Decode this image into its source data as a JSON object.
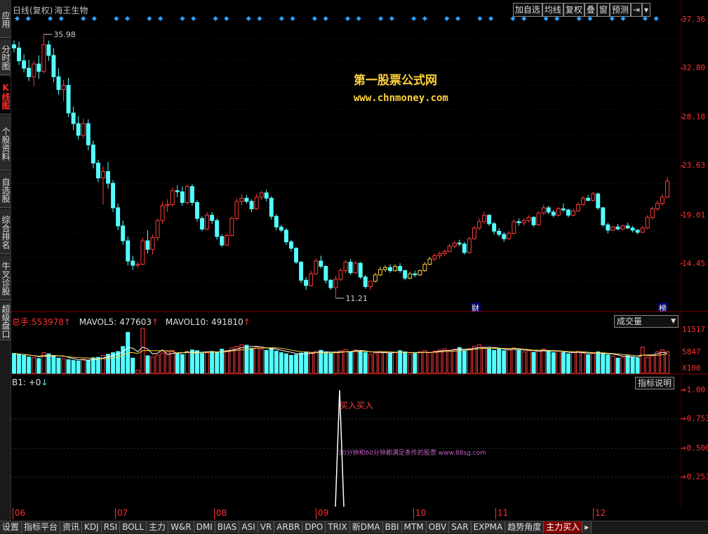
{
  "stock": {
    "period_label": "日线(复权)",
    "name": "海王生物"
  },
  "toolbar": [
    "加自选",
    "均线",
    "复权",
    "叠",
    "窗",
    "预测"
  ],
  "left_tabs": [
    {
      "label": "应用",
      "active": false
    },
    {
      "label": "分时图",
      "active": false
    },
    {
      "label": "K线图",
      "active": true
    },
    {
      "label": "个股资料",
      "active": false
    },
    {
      "label": "自选股",
      "active": false
    },
    {
      "label": "综合排名",
      "active": false
    },
    {
      "label": "牛叉诊股",
      "active": false
    },
    {
      "label": "超级盘口",
      "active": false
    }
  ],
  "price_axis": [
    "37.36",
    "32.80",
    "28.18",
    "23.63",
    "19.01",
    "14.45"
  ],
  "watermark": {
    "line1": "第一股票公式网",
    "line2": "www.chnmoney.com"
  },
  "annotations": {
    "high": "35.98",
    "low": "11.21",
    "cai": "财",
    "bang": "榜"
  },
  "volume": {
    "total_label": "总手:",
    "total_value": "553978",
    "mavol5_label": "MAVOL5:",
    "mavol5_value": "477603",
    "mavol10_label": "MAVOL10:",
    "mavol10_value": "491810",
    "selector": "成交量",
    "axis": [
      "11517",
      "5847",
      "X100"
    ]
  },
  "indicator": {
    "title": "B1: +0",
    "button": "指标说明",
    "signal_text": "买入买入",
    "small_text": "30分钟和60分钟都满足条件的股票 www.88sg.com",
    "axis": [
      "+1.00",
      "+0.753",
      "+0.500",
      "+0.253"
    ]
  },
  "months": [
    "06",
    "07",
    "08",
    "09",
    "10",
    "11",
    "12"
  ],
  "bottom_tabs": [
    "设置",
    "指标平台",
    "资讯",
    "KDJ",
    "RSI",
    "BOLL",
    "主力",
    "W&R",
    "DMI",
    "BIAS",
    "ASI",
    "VR",
    "ARBR",
    "DPO",
    "TRIX",
    "新DMA",
    "BBI",
    "MTM",
    "OBV",
    "SAR",
    "EXPMA",
    "趋势角度",
    "主力买入"
  ],
  "active_bottom_tab": "主力买入",
  "colors": {
    "up": "#ff3c3c",
    "down": "#54ffff",
    "axis": "#ff3030",
    "grid": "#800000",
    "yellow": "#ffd23c",
    "ma": "#ffffff"
  },
  "chart_data": {
    "type": "candlestick",
    "ylim": [
      11.21,
      37.36
    ],
    "candles": [
      [
        35,
        35.4,
        34.3,
        34.7
      ],
      [
        34.7,
        35.3,
        33.1,
        33.5
      ],
      [
        33.5,
        34.1,
        32.4,
        32.8
      ],
      [
        32.8,
        33.6,
        31.6,
        32.0
      ],
      [
        32.0,
        33.5,
        31.1,
        33.2
      ],
      [
        33.2,
        34.0,
        31.8,
        32.5
      ],
      [
        32.5,
        35.98,
        32.3,
        35.0
      ],
      [
        35.0,
        35.4,
        33.5,
        34.0
      ],
      [
        34.0,
        34.7,
        31.5,
        32.0
      ],
      [
        32.0,
        32.8,
        30.3,
        30.8
      ],
      [
        30.8,
        31.7,
        29.7,
        31.2
      ],
      [
        31.2,
        31.9,
        28.2,
        28.6
      ],
      [
        28.6,
        29.2,
        27.0,
        27.6
      ],
      [
        27.6,
        28.3,
        26.1,
        26.5
      ],
      [
        26.5,
        28.1,
        26.2,
        27.6
      ],
      [
        27.6,
        28.0,
        25.1,
        25.6
      ],
      [
        25.6,
        26.0,
        23.4,
        23.9
      ],
      [
        23.9,
        24.2,
        22.1,
        22.5
      ],
      [
        22.5,
        23.6,
        20.0,
        23.1
      ],
      [
        23.1,
        24.0,
        21.5,
        22.0
      ],
      [
        22.0,
        22.3,
        19.3,
        19.7
      ],
      [
        19.7,
        20.1,
        17.6,
        18.0
      ],
      [
        18.0,
        18.5,
        16.2,
        16.6
      ],
      [
        16.6,
        17.0,
        14.3,
        14.7
      ],
      [
        14.7,
        15.2,
        13.9,
        14.3
      ],
      [
        14.3,
        14.6,
        14.0,
        14.4
      ],
      [
        14.4,
        16.9,
        14.3,
        16.6
      ],
      [
        16.6,
        17.6,
        15.4,
        15.8
      ],
      [
        15.8,
        17.2,
        15.3,
        16.9
      ],
      [
        16.9,
        18.7,
        16.6,
        18.5
      ],
      [
        18.5,
        20.3,
        18.2,
        19.9
      ],
      [
        19.9,
        20.5,
        19.3,
        20.0
      ],
      [
        20.0,
        21.6,
        19.8,
        21.3
      ],
      [
        21.3,
        21.8,
        20.7,
        21.2
      ],
      [
        21.2,
        21.7,
        19.9,
        20.2
      ],
      [
        20.2,
        21.9,
        20.0,
        21.7
      ],
      [
        21.7,
        21.9,
        19.9,
        20.2
      ],
      [
        20.2,
        20.4,
        18.4,
        18.7
      ],
      [
        18.7,
        18.9,
        17.5,
        17.7
      ],
      [
        17.7,
        19.3,
        17.6,
        19.0
      ],
      [
        19.0,
        19.3,
        18.2,
        18.5
      ],
      [
        18.5,
        18.7,
        16.7,
        17.0
      ],
      [
        17.0,
        17.2,
        16.0,
        16.2
      ],
      [
        16.2,
        17.3,
        16.1,
        17.1
      ],
      [
        17.1,
        18.9,
        17.0,
        18.7
      ],
      [
        18.7,
        20.6,
        18.5,
        20.3
      ],
      [
        20.3,
        21.0,
        19.9,
        20.6
      ],
      [
        20.6,
        20.9,
        20.1,
        20.3
      ],
      [
        20.3,
        20.5,
        19.3,
        19.6
      ],
      [
        19.6,
        21.0,
        19.5,
        20.7
      ],
      [
        20.7,
        21.3,
        20.4,
        21.1
      ],
      [
        21.1,
        21.4,
        20.3,
        20.6
      ],
      [
        20.6,
        20.8,
        18.6,
        18.9
      ],
      [
        18.9,
        19.1,
        17.6,
        17.9
      ],
      [
        17.9,
        18.1,
        17.4,
        17.6
      ],
      [
        17.6,
        17.8,
        16.2,
        16.5
      ],
      [
        16.5,
        16.7,
        15.6,
        15.9
      ],
      [
        15.9,
        16.0,
        14.4,
        14.6
      ],
      [
        14.6,
        14.7,
        12.6,
        12.9
      ],
      [
        12.9,
        13.2,
        12.0,
        12.4
      ],
      [
        12.4,
        13.8,
        12.3,
        13.5
      ],
      [
        13.5,
        15.0,
        13.4,
        14.7
      ],
      [
        14.7,
        15.2,
        14.0,
        14.2
      ],
      [
        14.2,
        14.3,
        12.6,
        12.9
      ],
      [
        12.9,
        13.0,
        12.0,
        12.2
      ],
      [
        12.2,
        13.3,
        11.21,
        13.0
      ],
      [
        13.0,
        14.0,
        12.8,
        13.8
      ],
      [
        13.8,
        14.8,
        13.6,
        14.6
      ],
      [
        14.6,
        14.9,
        13.4,
        13.6
      ],
      [
        13.6,
        14.7,
        13.5,
        14.5
      ],
      [
        14.5,
        14.6,
        13.0,
        13.2
      ],
      [
        13.2,
        13.4,
        12.1,
        12.3
      ],
      [
        12.3,
        12.5,
        12.0,
        12.8
      ],
      [
        12.8,
        13.6,
        12.7,
        13.4
      ],
      [
        13.4,
        14.2,
        13.3,
        13.9
      ],
      [
        13.9,
        14.3,
        13.7,
        14.1
      ],
      [
        14.1,
        14.4,
        13.6,
        13.8
      ],
      [
        13.8,
        14.4,
        13.7,
        14.2
      ],
      [
        14.2,
        14.5,
        13.6,
        13.8
      ],
      [
        13.8,
        13.9,
        12.9,
        13.1
      ],
      [
        13.1,
        13.7,
        13.0,
        13.5
      ],
      [
        13.5,
        13.8,
        13.2,
        13.4
      ],
      [
        13.4,
        13.9,
        13.3,
        13.8
      ],
      [
        13.8,
        14.6,
        13.7,
        14.4
      ],
      [
        14.4,
        15.1,
        14.3,
        14.9
      ],
      [
        14.9,
        15.4,
        14.7,
        15.2
      ],
      [
        15.2,
        15.6,
        14.9,
        15.4
      ],
      [
        15.4,
        15.8,
        15.2,
        15.6
      ],
      [
        15.6,
        16.3,
        15.5,
        16.1
      ],
      [
        16.1,
        16.6,
        15.9,
        16.4
      ],
      [
        16.4,
        16.7,
        16.1,
        16.3
      ],
      [
        16.3,
        16.5,
        15.3,
        15.5
      ],
      [
        15.5,
        17.0,
        15.4,
        16.8
      ],
      [
        16.8,
        18.0,
        16.7,
        17.8
      ],
      [
        17.8,
        18.7,
        17.6,
        18.4
      ],
      [
        18.4,
        19.3,
        18.2,
        19.0
      ],
      [
        19.0,
        19.1,
        18.0,
        18.2
      ],
      [
        18.2,
        18.4,
        17.2,
        17.5
      ],
      [
        17.5,
        17.8,
        17.0,
        17.2
      ],
      [
        17.2,
        17.4,
        16.5,
        16.8
      ],
      [
        16.8,
        17.5,
        16.7,
        17.3
      ],
      [
        17.3,
        18.6,
        17.2,
        18.4
      ],
      [
        18.4,
        18.7,
        18.0,
        18.3
      ],
      [
        18.3,
        18.7,
        18.0,
        18.5
      ],
      [
        18.5,
        19.0,
        18.3,
        18.8
      ],
      [
        18.8,
        18.9,
        17.9,
        18.1
      ],
      [
        18.1,
        19.4,
        18.0,
        19.2
      ],
      [
        19.2,
        20.0,
        19.0,
        19.7
      ],
      [
        19.7,
        19.9,
        19.1,
        19.3
      ],
      [
        19.3,
        19.5,
        18.8,
        19.0
      ],
      [
        19.0,
        19.8,
        18.9,
        19.6
      ],
      [
        19.6,
        20.1,
        19.3,
        19.5
      ],
      [
        19.5,
        19.6,
        18.8,
        19.0
      ],
      [
        19.0,
        19.6,
        18.9,
        19.4
      ],
      [
        19.4,
        20.2,
        19.3,
        20.0
      ],
      [
        20.0,
        20.8,
        19.9,
        20.6
      ],
      [
        20.6,
        20.9,
        20.3,
        20.4
      ],
      [
        20.4,
        21.2,
        20.3,
        21.0
      ],
      [
        21.0,
        21.1,
        19.5,
        19.7
      ],
      [
        19.7,
        19.8,
        17.9,
        18.1
      ],
      [
        18.1,
        18.3,
        17.3,
        17.6
      ],
      [
        17.6,
        18.0,
        17.5,
        17.9
      ],
      [
        17.9,
        18.2,
        17.6,
        17.7
      ],
      [
        17.7,
        18.1,
        17.6,
        18.0
      ],
      [
        18.0,
        18.3,
        17.7,
        17.8
      ],
      [
        17.8,
        18.0,
        17.4,
        17.6
      ],
      [
        17.6,
        17.7,
        17.2,
        17.4
      ],
      [
        17.4,
        18.0,
        17.3,
        17.8
      ],
      [
        17.8,
        19.0,
        17.7,
        18.8
      ],
      [
        18.8,
        19.8,
        18.6,
        19.6
      ],
      [
        19.6,
        20.4,
        19.4,
        20.1
      ],
      [
        20.1,
        21.0,
        19.9,
        20.7
      ],
      [
        20.7,
        22.6,
        20.6,
        22.2
      ]
    ],
    "volumes": [
      5100,
      4800,
      4600,
      4200,
      4000,
      3800,
      5300,
      5000,
      4400,
      3900,
      3700,
      3500,
      3300,
      3200,
      3600,
      3400,
      4000,
      4100,
      4600,
      4900,
      5300,
      5600,
      6900,
      10500,
      3900,
      800,
      11517,
      4500,
      4200,
      4700,
      5200,
      5500,
      5900,
      5000,
      4800,
      5400,
      6000,
      5800,
      5100,
      5300,
      5600,
      5500,
      6200,
      5900,
      6500,
      6900,
      7300,
      7200,
      6400,
      6800,
      6200,
      5900,
      6400,
      5700,
      5300,
      5000,
      4600,
      4800,
      5200,
      5500,
      5300,
      5600,
      5900,
      5300,
      5000,
      5400,
      5800,
      6100,
      5600,
      6000,
      5700,
      5300,
      4900,
      5200,
      5600,
      5400,
      5100,
      5300,
      5800,
      5500,
      4900,
      5100,
      5500,
      5800,
      5300,
      5700,
      6000,
      6300,
      5900,
      6200,
      6600,
      5900,
      6300,
      6900,
      7300,
      6700,
      6200,
      5900,
      6300,
      5800,
      6100,
      6500,
      5900,
      5500,
      5800,
      5400,
      5900,
      6200,
      5600,
      5300,
      5700,
      5400,
      5000,
      5300,
      5600,
      5200,
      4800,
      5100,
      5500,
      5000,
      4700,
      4400,
      3900,
      4100,
      4500,
      4200,
      3900,
      6700,
      4100,
      4700,
      5500,
      6000,
      5600
    ]
  }
}
